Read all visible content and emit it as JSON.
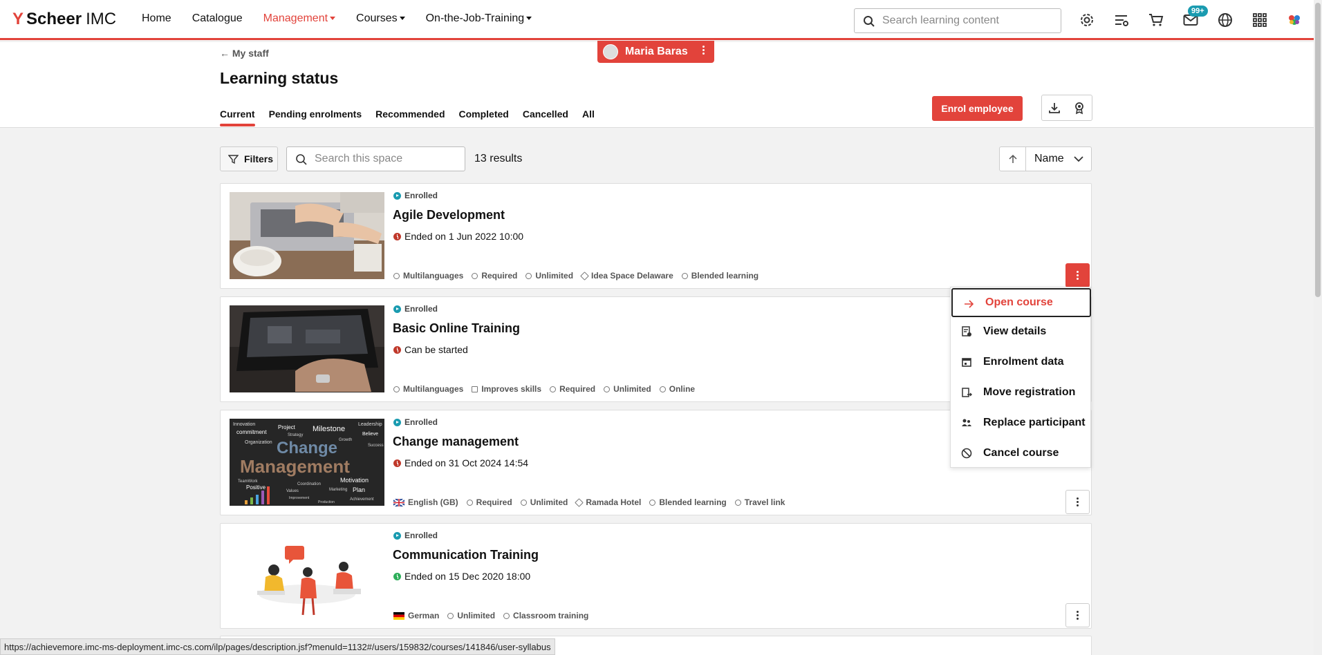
{
  "nav": {
    "logo_bold": "Scheer",
    "logo_light": "IMC",
    "items": [
      {
        "label": "Home",
        "active": false,
        "dropdown": false
      },
      {
        "label": "Catalogue",
        "active": false,
        "dropdown": false
      },
      {
        "label": "Management",
        "active": true,
        "dropdown": true
      },
      {
        "label": "Courses",
        "active": false,
        "dropdown": true
      },
      {
        "label": "On-the-Job-Training",
        "active": false,
        "dropdown": true
      }
    ],
    "search_placeholder": "Search learning content",
    "inbox_badge": "99+",
    "accent": "#e2433b"
  },
  "header": {
    "user_name": "Maria Baras",
    "back_link": "My staff",
    "title": "Learning status",
    "tabs": [
      "Current",
      "Pending enrolments",
      "Recommended",
      "Completed",
      "Cancelled",
      "All"
    ],
    "enrol_button": "Enrol employee"
  },
  "toolbar": {
    "filters_label": "Filters",
    "search_placeholder": "Search this space",
    "results": "13 results",
    "sort_label": "Name"
  },
  "courses": [
    {
      "status": "Enrolled",
      "title": "Agile Development",
      "date": "Ended on 1 Jun 2022 10:00",
      "meta": [
        "Multilanguages",
        "Required",
        "Unlimited",
        "Idea Space Delaware",
        "Blended learning"
      ]
    },
    {
      "status": "Enrolled",
      "title": "Basic Online Training",
      "date": "Can be started",
      "meta": [
        "Multilanguages",
        "Improves skills",
        "Required",
        "Unlimited",
        "Online"
      ]
    },
    {
      "status": "Enrolled",
      "title": "Change management",
      "date": "Ended on 31 Oct 2024 14:54",
      "meta": [
        "English (GB)",
        "Required",
        "Unlimited",
        "Ramada Hotel",
        "Blended learning",
        "Travel link"
      ],
      "thumb_words": [
        "Change",
        "Management",
        "Innovation",
        "commitment",
        "Project",
        "Strategy",
        "Milestone",
        "Leadership",
        "Believe",
        "Organization",
        "Growth",
        "Success",
        "TeamWork",
        "Positive",
        "Coordination",
        "Motivation",
        "Plan",
        "Values",
        "Marketing",
        "Achievement",
        "Production",
        "Improvement"
      ]
    },
    {
      "status": "Enrolled",
      "title": "Communication Training",
      "date": "Ended on 15 Dec 2020 18:00",
      "meta": [
        "German",
        "Unlimited",
        "Classroom training"
      ]
    }
  ],
  "menu": {
    "items": [
      "Open course",
      "View details",
      "Enrolment data",
      "Move registration",
      "Replace participant",
      "Cancel course"
    ]
  },
  "statusbar": {
    "url": "https://achievemore.imc-ms-deployment.imc-cs.com/ilp/pages/description.jsf?menuId=1132#/users/159832/courses/141846/user-syllabus"
  }
}
